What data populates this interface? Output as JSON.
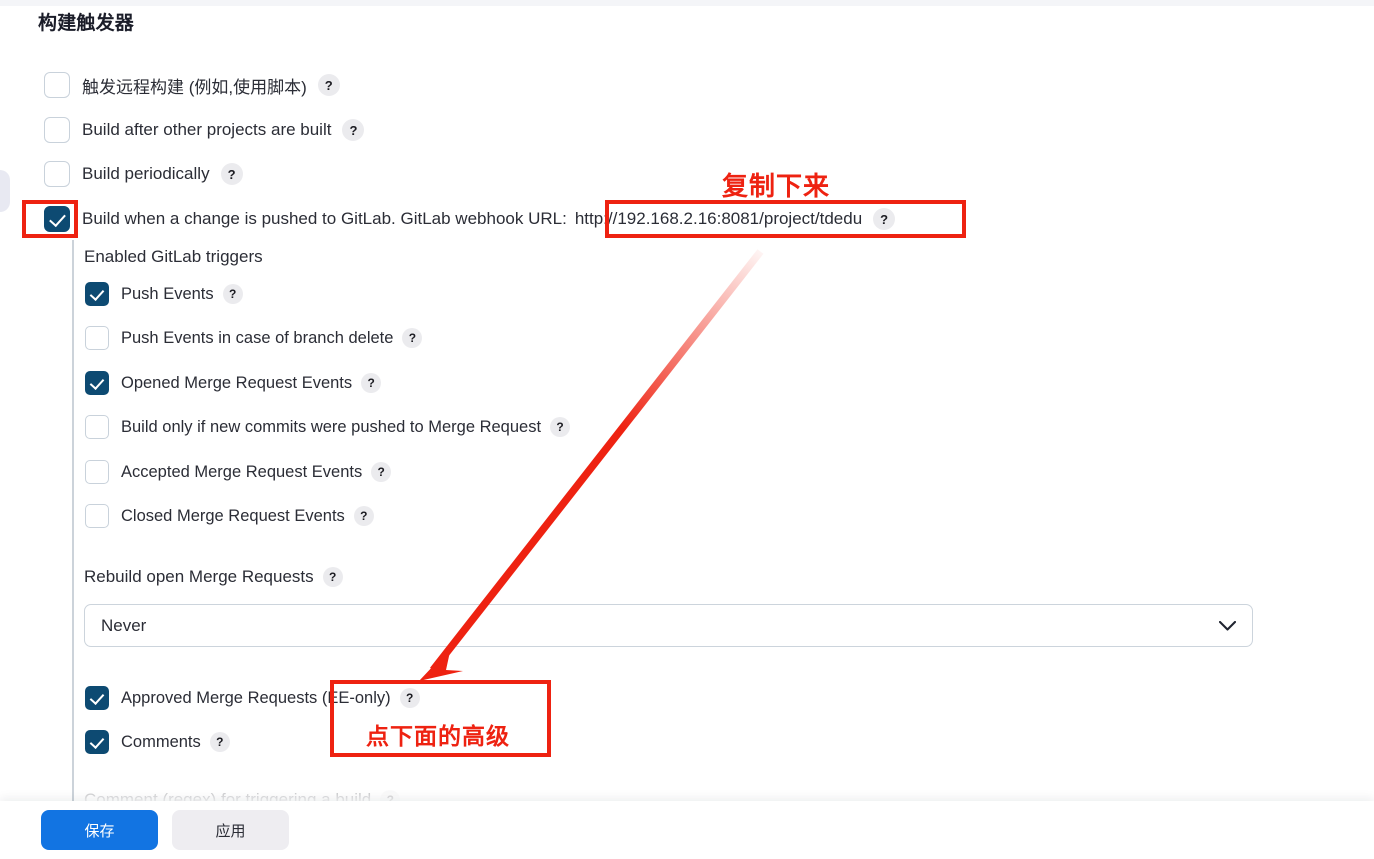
{
  "page": {
    "title": "构建触发器"
  },
  "triggers": [
    {
      "label": "触发远程构建 (例如,使用脚本)",
      "checked": false,
      "help": "?"
    },
    {
      "label": "Build after other projects are built",
      "checked": false,
      "help": "?"
    },
    {
      "label": "Build periodically",
      "checked": false,
      "help": "?"
    },
    {
      "label": "Build when a change is pushed to GitLab. GitLab webhook URL:",
      "checked": true,
      "help": "?"
    }
  ],
  "webhook": {
    "url": "http://192.168.2.16:8081/project/tdedu"
  },
  "gitlab": {
    "section_label": "Enabled GitLab triggers",
    "events": [
      {
        "label": "Push Events",
        "checked": true,
        "help": "?"
      },
      {
        "label": "Push Events in case of branch delete",
        "checked": false,
        "help": "?"
      },
      {
        "label": "Opened Merge Request Events",
        "checked": true,
        "help": "?"
      },
      {
        "label": "Build only if new commits were pushed to Merge Request",
        "checked": false,
        "help": "?"
      },
      {
        "label": "Accepted Merge Request Events",
        "checked": false,
        "help": "?"
      },
      {
        "label": "Closed Merge Request Events",
        "checked": false,
        "help": "?"
      }
    ],
    "rebuild_label": "Rebuild open Merge Requests",
    "rebuild_help": "?",
    "rebuild_value": "Never",
    "post_events": [
      {
        "label": "Approved Merge Requests (EE-only)",
        "checked": true,
        "help": "?"
      },
      {
        "label": "Comments",
        "checked": true,
        "help": "?"
      }
    ],
    "cut_off_row": {
      "label": "Comment (regex) for triggering a build",
      "help": "?"
    }
  },
  "footer": {
    "save_label": "保存",
    "apply_label": "应用"
  },
  "annotations": {
    "copy_note": "复制下来",
    "advanced_note": "点下面的高级",
    "color": "#ee2211"
  },
  "colors": {
    "checkbox_checked": "#0d4a72",
    "primary_button": "#1274e2",
    "secondary_button": "#eeedf1",
    "annotation_red": "#ee2211",
    "text": "#2b2d36"
  }
}
